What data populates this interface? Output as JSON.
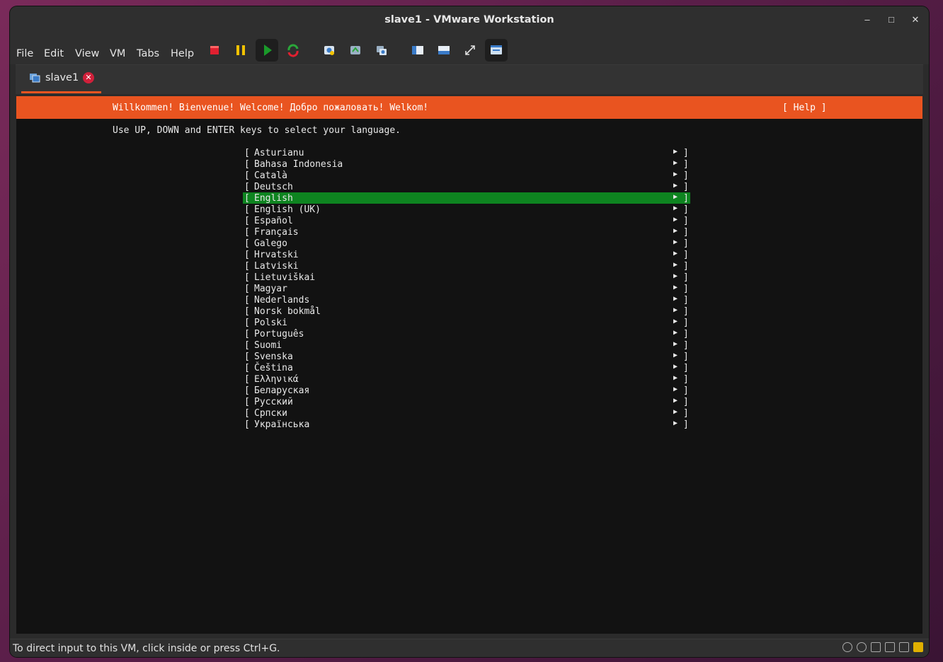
{
  "window": {
    "title": "slave1 - VMware Workstation",
    "controls": [
      "minimize-icon",
      "maximize-icon",
      "close-icon"
    ]
  },
  "menu": {
    "items": [
      "File",
      "Edit",
      "View",
      "VM",
      "Tabs",
      "Help"
    ]
  },
  "toolbar": {
    "icons": [
      "power-off-icon",
      "pause-icon",
      "play-icon",
      "restart-icon",
      "snapshot-icon",
      "revert-snapshot-icon",
      "snapshot-manager-icon",
      "library-view-icon",
      "thumbnail-view-icon",
      "fullscreen-icon",
      "unity-view-icon"
    ]
  },
  "tab": {
    "label": "slave1"
  },
  "vm": {
    "banner": "Willkommen! Bienvenue! Welcome! Добро пожаловать! Welkom!",
    "help": "[ Help ]",
    "instruction": "Use UP, DOWN and ENTER keys to select your language.",
    "languages": [
      "Asturianu",
      "Bahasa Indonesia",
      "Català",
      "Deutsch",
      "English",
      "English (UK)",
      "Español",
      "Français",
      "Galego",
      "Hrvatski",
      "Latviski",
      "Lietuviškai",
      "Magyar",
      "Nederlands",
      "Norsk bokmål",
      "Polski",
      "Português",
      "Suomi",
      "Svenska",
      "Čeština",
      "Ελληνικά",
      "Беларуская",
      "Русский",
      "Српски",
      "Українська"
    ],
    "selected": "English",
    "left_bracket": "[",
    "right_bracket": "]",
    "arrow": "▶"
  },
  "status": {
    "text": "To direct input to this VM, click inside or press Ctrl+G."
  },
  "colors": {
    "accent": "#e95420",
    "selection": "#0e8420"
  }
}
